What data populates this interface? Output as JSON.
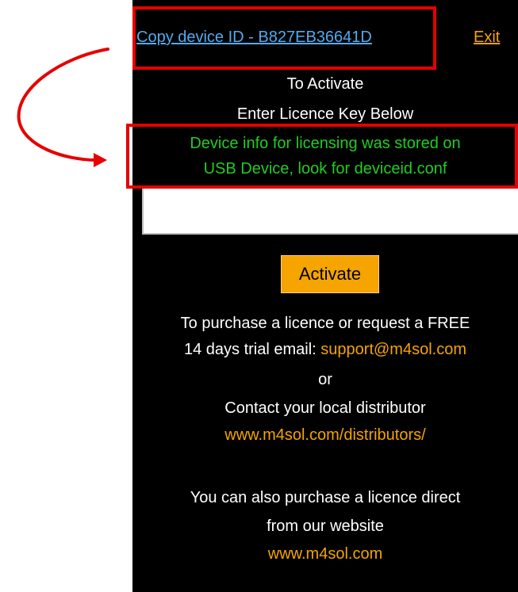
{
  "header": {
    "copy_device_id": "Copy device ID - B827EB36641D",
    "exit": "Exit"
  },
  "activate": {
    "line1": "To Activate",
    "line2": "Enter Licence Key Below",
    "notice_line1": "Device info for licensing was stored on",
    "notice_line2": "USB Device, look for deviceid.conf",
    "licence_key_value": "",
    "button_label": "Activate"
  },
  "purchase": {
    "line1": "To purchase a licence or request a FREE",
    "line2_prefix": "14 days trial email:",
    "email": "support@m4sol.com",
    "or": "or",
    "distributor_text": "Contact your local distributor",
    "distributor_link": "www.m4sol.com/distributors/",
    "direct_line1": "You can also purchase a licence direct",
    "direct_line2": "from our website",
    "website_link": "www.m4sol.com"
  },
  "colors": {
    "panel_background": "#000000",
    "link_blue": "#55aaee",
    "accent_orange": "#f5a400",
    "notice_green": "#22cc22",
    "annotation_red": "#e60000"
  },
  "annotations": [
    "highlight-box-device-id",
    "highlight-box-notice",
    "curved-arrow"
  ]
}
